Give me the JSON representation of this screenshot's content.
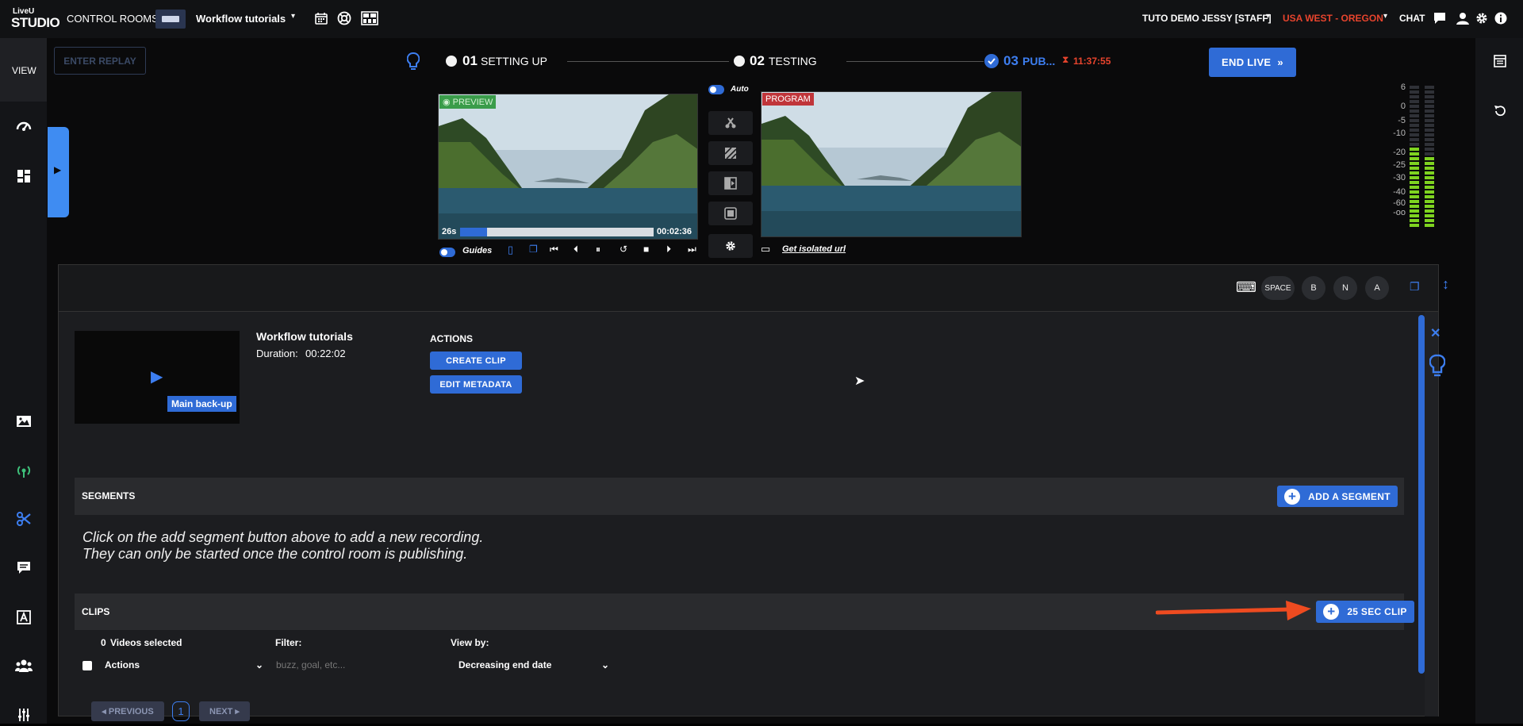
{
  "topbar": {
    "logo_top": "LiveU",
    "logo_bottom": "STUDIO",
    "control_rooms": "CONTROL ROOMS",
    "room_name": "Workflow tutorials",
    "user": "TUTO DEMO JESSY [STAFF]",
    "region": "USA WEST - OREGON",
    "chat": "CHAT"
  },
  "colors": {
    "accent": "#2f6bd6",
    "region": "#e8442d",
    "timer": "#e8442d",
    "preview_tag": "#3a9c4a",
    "program_tag": "#c0353a"
  },
  "leftnav": {
    "view": "VIEW"
  },
  "steps": {
    "enter_replay": "ENTER REPLAY",
    "s1_num": "01",
    "s1_label": "SETTING UP",
    "s2_num": "02",
    "s2_label": "TESTING",
    "s3_num": "03",
    "s3_label": "PUB...",
    "timer": "11:37:55",
    "end_live": "END LIVE"
  },
  "monitors": {
    "preview_label": "PREVIEW",
    "program_label": "PROGRAM",
    "auto": "Auto",
    "elapsed": "26s",
    "total": "00:02:36",
    "progress": 0.14,
    "guides": "Guides",
    "isolated_url": "Get isolated url"
  },
  "audio_meter": {
    "ticks": [
      "6",
      "0",
      "-5",
      "-10",
      "-20",
      "-25",
      "-30",
      "-40",
      "-60",
      "-oo"
    ]
  },
  "shortcuts": {
    "space": "SPACE",
    "b": "B",
    "n": "N",
    "a": "A"
  },
  "recording": {
    "title": "Workflow tutorials",
    "duration_label": "Duration:",
    "duration": "00:22:02",
    "thumb_label": "Main back-up",
    "actions_title": "ACTIONS",
    "create_clip": "CREATE CLIP",
    "edit_metadata": "EDIT METADATA"
  },
  "segments": {
    "title": "SEGMENTS",
    "add": "ADD A SEGMENT",
    "msg1": "Click on the add segment button above to add a new recording.",
    "msg2": "They can only be started once the control room is publishing."
  },
  "clips": {
    "title": "CLIPS",
    "clip_btn": "25 SEC CLIP",
    "selected_count": "0",
    "selected_label": "Videos selected",
    "filter_label": "Filter:",
    "viewby_label": "View by:",
    "actions_select": "Actions",
    "filter_placeholder": "buzz, goal, etc...",
    "viewby_value": "Decreasing end date",
    "prev": "PREVIOUS",
    "page": "1",
    "next": "NEXT"
  }
}
